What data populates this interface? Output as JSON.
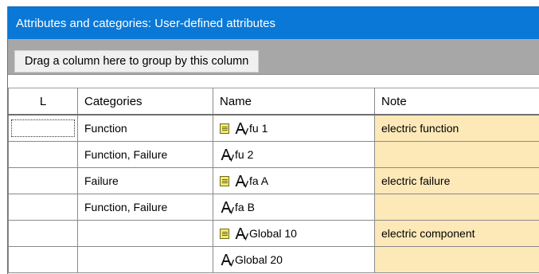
{
  "panel": {
    "title": "Attributes and categories: User-defined attributes",
    "group_hint": "Drag a column here to group by this column"
  },
  "columns": {
    "l": "L",
    "categories": "Categories",
    "name": "Name",
    "note": "Note"
  },
  "rows": [
    {
      "categories": "Function",
      "name": "fu 1",
      "note": "electric function",
      "has_doc_icon": true
    },
    {
      "categories": "Function, Failure",
      "name": "fu 2",
      "note": "",
      "has_doc_icon": false
    },
    {
      "categories": "Failure",
      "name": "fa A",
      "note": "electric failure",
      "has_doc_icon": true
    },
    {
      "categories": "Function, Failure",
      "name": "fa B",
      "note": "",
      "has_doc_icon": false
    },
    {
      "categories": "",
      "name": "Global 10",
      "note": "electric component",
      "has_doc_icon": true
    },
    {
      "categories": "",
      "name": "Global 20",
      "note": "",
      "has_doc_icon": false
    }
  ],
  "colors": {
    "title_bg": "#0a78d7",
    "group_bar_bg": "#a7a7a7",
    "note_bg": "#fde9b8"
  },
  "icons": {
    "doc": "document-icon",
    "attribute": "attribute-a-icon"
  }
}
